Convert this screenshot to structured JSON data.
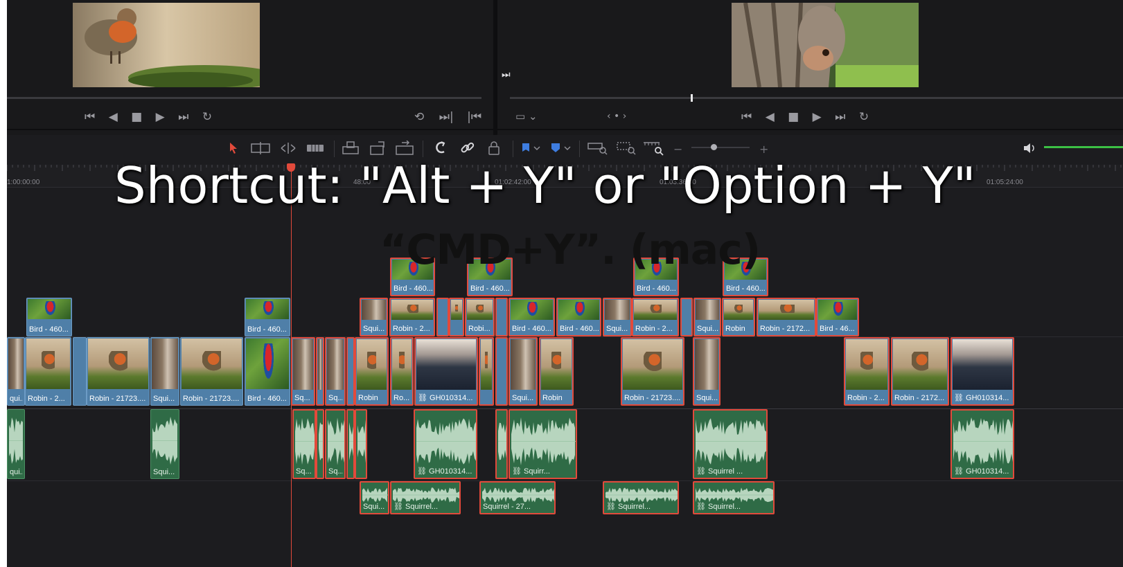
{
  "overlay": {
    "headline": "Shortcut: \"Alt + Y\" or \"Option + Y\"",
    "subline": "“CMD+Y”. (mac)"
  },
  "source_viewer": {
    "thumbnail": "robin-on-moss",
    "transport": [
      "⏮",
      "◀",
      "■",
      "▶",
      "⏭",
      "↻"
    ],
    "right_controls": [
      "⟲",
      "⏭|",
      "|⏮"
    ]
  },
  "timeline_viewer": {
    "thumbnail": "squirrel-on-tree",
    "left_icon": "⏭",
    "aspect_control": "▭ ⌄",
    "nav_control": "‹ • ›",
    "transport": [
      "⏮",
      "◀",
      "■",
      "▶",
      "⏭",
      "↻"
    ]
  },
  "toolbar": {
    "icons": [
      "select-arrow-icon",
      "trim-icon",
      "dynamic-trim-icon",
      "blade-icon",
      "insert-icon",
      "overwrite-icon",
      "replace-icon",
      "snap-icon",
      "link-icon",
      "lock-icon",
      "flag-icon",
      "marker-icon",
      "zoom-full-icon",
      "zoom-detail-icon",
      "zoom-custom-icon",
      "zoom-out-icon",
      "zoom-slider",
      "zoom-in-icon",
      "volume-icon"
    ],
    "minus": "−",
    "plus": "+"
  },
  "ruler": {
    "ticks": [
      "1:00:00:00",
      "48:00",
      "01:02:42:00",
      "01:03:36:00",
      "01:05:24:00"
    ]
  },
  "clips": {
    "v3": [
      {
        "label": "Bird - 460...",
        "pic": "bird",
        "selected": true
      },
      {
        "label": "Bird - 460...",
        "pic": "bird",
        "selected": true
      },
      {
        "label": "Bird - 460...",
        "pic": "bird",
        "selected": true
      },
      {
        "label": "Bird - 460...",
        "pic": "bird",
        "selected": true
      }
    ],
    "v2": [
      {
        "label": "Bird - 460...",
        "pic": "bird",
        "selected": false
      },
      {
        "label": "Bird - 460...",
        "pic": "bird",
        "selected": false
      },
      {
        "label": "Squi...",
        "pic": "squi",
        "selected": true
      },
      {
        "label": "Robin - 2...",
        "pic": "robin",
        "selected": true
      },
      {
        "label": "",
        "pic": "blank",
        "selected": true
      },
      {
        "label": "",
        "pic": "robin",
        "selected": true
      },
      {
        "label": "Robi...",
        "pic": "robin",
        "selected": true
      },
      {
        "label": "",
        "pic": "blank",
        "selected": true
      },
      {
        "label": "Bird - 460...",
        "pic": "bird",
        "selected": true
      },
      {
        "label": "Bird - 460...",
        "pic": "bird",
        "selected": true
      },
      {
        "label": "Squi...",
        "pic": "squi",
        "selected": true
      },
      {
        "label": "Robin - 2...",
        "pic": "robin",
        "selected": true
      },
      {
        "label": "",
        "pic": "blank",
        "selected": true
      },
      {
        "label": "Squi...",
        "pic": "squi",
        "selected": true
      },
      {
        "label": "Robin",
        "pic": "robin",
        "selected": true
      },
      {
        "label": "Robin - 2172...",
        "pic": "robin",
        "selected": true
      },
      {
        "label": "Bird - 46...",
        "pic": "bird",
        "selected": true
      }
    ],
    "v1": [
      {
        "label": "qui...",
        "pic": "squi",
        "selected": false
      },
      {
        "label": "Robin - 2...",
        "pic": "robin",
        "selected": false
      },
      {
        "label": "",
        "pic": "blank",
        "selected": false
      },
      {
        "label": "Robin - 21723....",
        "pic": "robin",
        "selected": false
      },
      {
        "label": "Squi...",
        "pic": "squi",
        "selected": false
      },
      {
        "label": "Robin - 21723....",
        "pic": "robin",
        "selected": false
      },
      {
        "label": "Bird - 460...",
        "pic": "bird",
        "selected": false
      },
      {
        "label": "Sq...",
        "pic": "squi",
        "selected": true
      },
      {
        "label": "",
        "pic": "squi",
        "selected": true
      },
      {
        "label": "Sq...",
        "pic": "squi",
        "selected": true
      },
      {
        "label": "",
        "pic": "blank",
        "selected": true
      },
      {
        "label": "Robin",
        "pic": "robin",
        "selected": true
      },
      {
        "label": "Ro...",
        "pic": "robin",
        "selected": true
      },
      {
        "label": "⛓ GH010314...",
        "pic": "gh",
        "selected": true
      },
      {
        "label": "",
        "pic": "robin",
        "selected": true
      },
      {
        "label": "",
        "pic": "blank",
        "selected": true
      },
      {
        "label": "Squi...",
        "pic": "squi",
        "selected": true
      },
      {
        "label": "Robin",
        "pic": "robin",
        "selected": true
      },
      {
        "label": "Robin - 21723....",
        "pic": "robin",
        "selected": true
      },
      {
        "label": "Squi...",
        "pic": "squi",
        "selected": true
      },
      {
        "label": "Robin - 2...",
        "pic": "robin",
        "selected": true
      },
      {
        "label": "Robin - 2172...",
        "pic": "robin",
        "selected": true
      },
      {
        "label": "⛓ GH010314...",
        "pic": "gh",
        "selected": true
      }
    ],
    "a1": [
      {
        "label": "qui...",
        "selected": false
      },
      {
        "label": "Squi...",
        "selected": false
      },
      {
        "label": "Sq...",
        "selected": true
      },
      {
        "label": "",
        "selected": true
      },
      {
        "label": "Sq...",
        "selected": true
      },
      {
        "label": "",
        "selected": true
      },
      {
        "label": "",
        "selected": true
      },
      {
        "label": "⛓ GH010314...",
        "selected": true
      },
      {
        "label": "",
        "selected": true
      },
      {
        "label": "⛓ Squirr...",
        "selected": true
      },
      {
        "label": "⛓ Squirrel ...",
        "selected": true
      },
      {
        "label": "⛓ GH010314...",
        "selected": true
      }
    ],
    "a2": [
      {
        "label": "Squi...",
        "selected": true
      },
      {
        "label": "⛓ Squirrel...",
        "selected": true
      },
      {
        "label": "Squirrel - 27...",
        "selected": true
      },
      {
        "label": "⛓ Squirrel...",
        "selected": true
      },
      {
        "label": "⛓ Squirrel...",
        "selected": true
      }
    ]
  },
  "colors": {
    "video_clip": "#4f7fa8",
    "audio_clip": "#2f6b46",
    "selection": "#e24a3b",
    "playhead": "#e24a3b",
    "level_meter": "#3cc145"
  }
}
